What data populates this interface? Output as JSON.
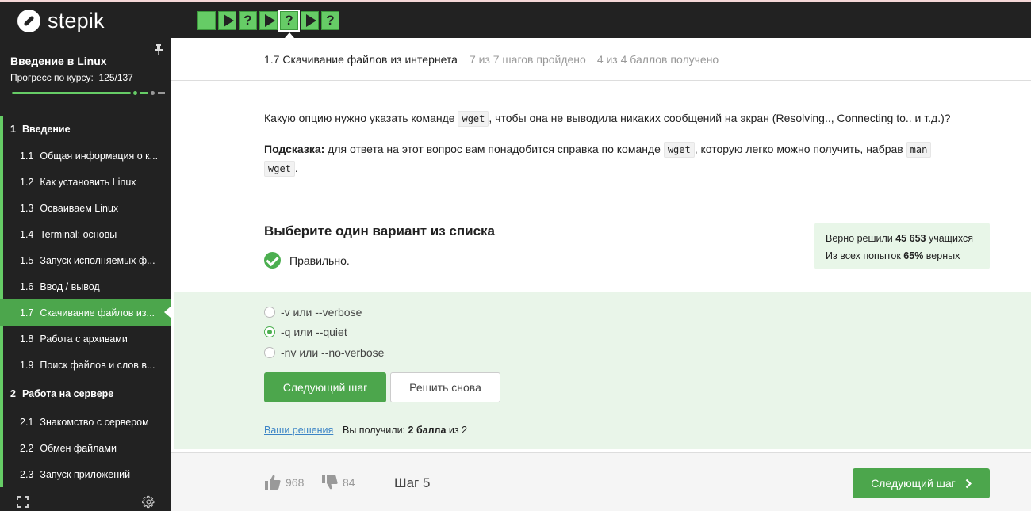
{
  "app": {
    "logo_text": "stepik"
  },
  "step_nav": [
    {
      "type": "blank"
    },
    {
      "type": "play"
    },
    {
      "type": "quiz",
      "label": "?"
    },
    {
      "type": "play"
    },
    {
      "type": "quiz",
      "label": "?",
      "active": true
    },
    {
      "type": "play"
    },
    {
      "type": "quiz",
      "label": "?"
    }
  ],
  "sidebar": {
    "course_title": "Введение в Linux",
    "progress_label": "Прогресс по курсу:",
    "progress_value": "125/137",
    "progress_fraction": 0.912,
    "sections": [
      {
        "number": "1",
        "title": "Введение"
      },
      {
        "number": "2",
        "title": "Работа на сервере"
      }
    ],
    "items": [
      {
        "number": "1.1",
        "label": "Общая информация о к..."
      },
      {
        "number": "1.2",
        "label": "Как установить Linux"
      },
      {
        "number": "1.3",
        "label": "Осваиваем Linux"
      },
      {
        "number": "1.4",
        "label": "Terminal: основы"
      },
      {
        "number": "1.5",
        "label": "Запуск исполняемых ф..."
      },
      {
        "number": "1.6",
        "label": "Ввод / вывод"
      },
      {
        "number": "1.7",
        "label": "Скачивание файлов из..."
      },
      {
        "number": "1.8",
        "label": "Работа с архивами"
      },
      {
        "number": "1.9",
        "label": "Поиск файлов и слов в..."
      },
      {
        "number": "2.1",
        "label": "Знакомство с сервером"
      },
      {
        "number": "2.2",
        "label": "Обмен файлами"
      },
      {
        "number": "2.3",
        "label": "Запуск приложений"
      }
    ]
  },
  "header": {
    "lesson": "1.7 Скачивание файлов из интернета",
    "steps_done": "7 из 7 шагов пройдено",
    "points": "4 из 4 баллов  получено"
  },
  "question": {
    "text_before": "Какую опцию нужно указать команде ",
    "code1": "wget",
    "text_after": ", чтобы она не выводила никаких сообщений на экран (Resolving.., Connecting to.. и т.д.)?",
    "hint_label": "Подсказка:",
    "hint_text": " для ответа на этот вопрос вам понадобится справка по команде ",
    "hint_code1": "wget",
    "hint_text2": ", которую легко можно получить, набрав ",
    "hint_code2a": "man",
    "hint_code2b": "wget",
    "hint_end": "."
  },
  "quiz": {
    "title": "Выберите один вариант из списка",
    "result": "Правильно.",
    "stats_line1_pre": "Верно решили ",
    "stats_line1_num": "45 653",
    "stats_line1_post": " учащихся",
    "stats_line2_pre": "Из всех попыток ",
    "stats_line2_num": "65%",
    "stats_line2_post": " верных",
    "options": [
      {
        "label": "-v или --verbose",
        "selected": false
      },
      {
        "label": "-q или --quiet",
        "selected": true
      },
      {
        "label": "-nv или --no-verbose",
        "selected": false
      }
    ],
    "next_button": "Следующий шаг",
    "retry_button": "Решить снова",
    "solutions_link": "Ваши решения",
    "score_pre": "Вы получили: ",
    "score_bold": "2 балла",
    "score_post": " из 2"
  },
  "footer": {
    "likes": "968",
    "dislikes": "84",
    "step_label": "Шаг 5",
    "next_button": "Следующий шаг"
  },
  "colors": {
    "accent": "#66cc66",
    "accent_dark": "#4ca64c",
    "sidebar_bg": "#222222",
    "link": "#3c84c6"
  }
}
